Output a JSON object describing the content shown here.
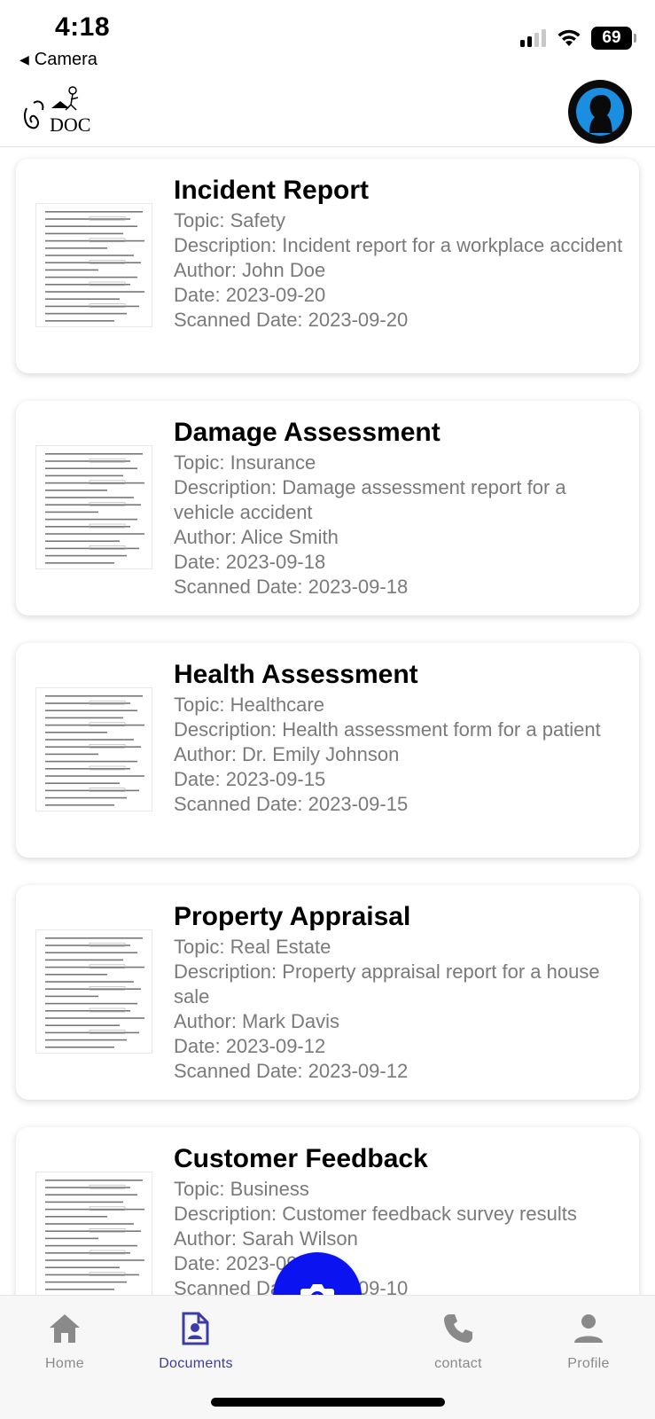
{
  "status_bar": {
    "time": "4:18",
    "back_app": "Camera",
    "battery": "69",
    "icons": [
      "cellular-signal-icon",
      "wifi-icon",
      "battery-icon"
    ]
  },
  "header": {
    "logo": "doc-logo",
    "logo_text": "DOC",
    "avatar": "user-avatar-icon"
  },
  "documents": [
    {
      "title": "Incident Report",
      "topic": "Topic: Safety",
      "description": "Description: Incident report for a workplace accident",
      "author": "Author: John Doe",
      "date": "Date: 2023-09-20",
      "scanned": "Scanned Date: 2023-09-20"
    },
    {
      "title": "Damage Assessment",
      "topic": "Topic: Insurance",
      "description": "Description: Damage assessment report for a vehicle accident",
      "author": "Author: Alice Smith",
      "date": "Date: 2023-09-18",
      "scanned": "Scanned Date: 2023-09-18"
    },
    {
      "title": "Health Assessment",
      "topic": "Topic: Healthcare",
      "description": "Description: Health assessment form for a patient",
      "author": "Author: Dr. Emily Johnson",
      "date": "Date: 2023-09-15",
      "scanned": "Scanned Date: 2023-09-15"
    },
    {
      "title": "Property Appraisal",
      "topic": "Topic: Real Estate",
      "description": "Description: Property appraisal report for a house sale",
      "author": "Author: Mark Davis",
      "date": "Date: 2023-09-12",
      "scanned": "Scanned Date: 2023-09-12"
    },
    {
      "title": "Customer Feedback",
      "topic": "Topic: Business",
      "description": "Description: Customer feedback survey results",
      "author": "Author: Sarah Wilson",
      "date": "Date: 2023-09-10",
      "scanned": "Scanned Date: 2023-09-10"
    }
  ],
  "nav": {
    "home": "Home",
    "documents": "Documents",
    "contact": "contact",
    "profile": "Profile",
    "active": "documents"
  },
  "colors": {
    "accent": "#0b14f0",
    "nav_active": "#3c3ca8",
    "nav_inactive": "#8a8a8a",
    "secondary_text": "#7a7a7a"
  }
}
